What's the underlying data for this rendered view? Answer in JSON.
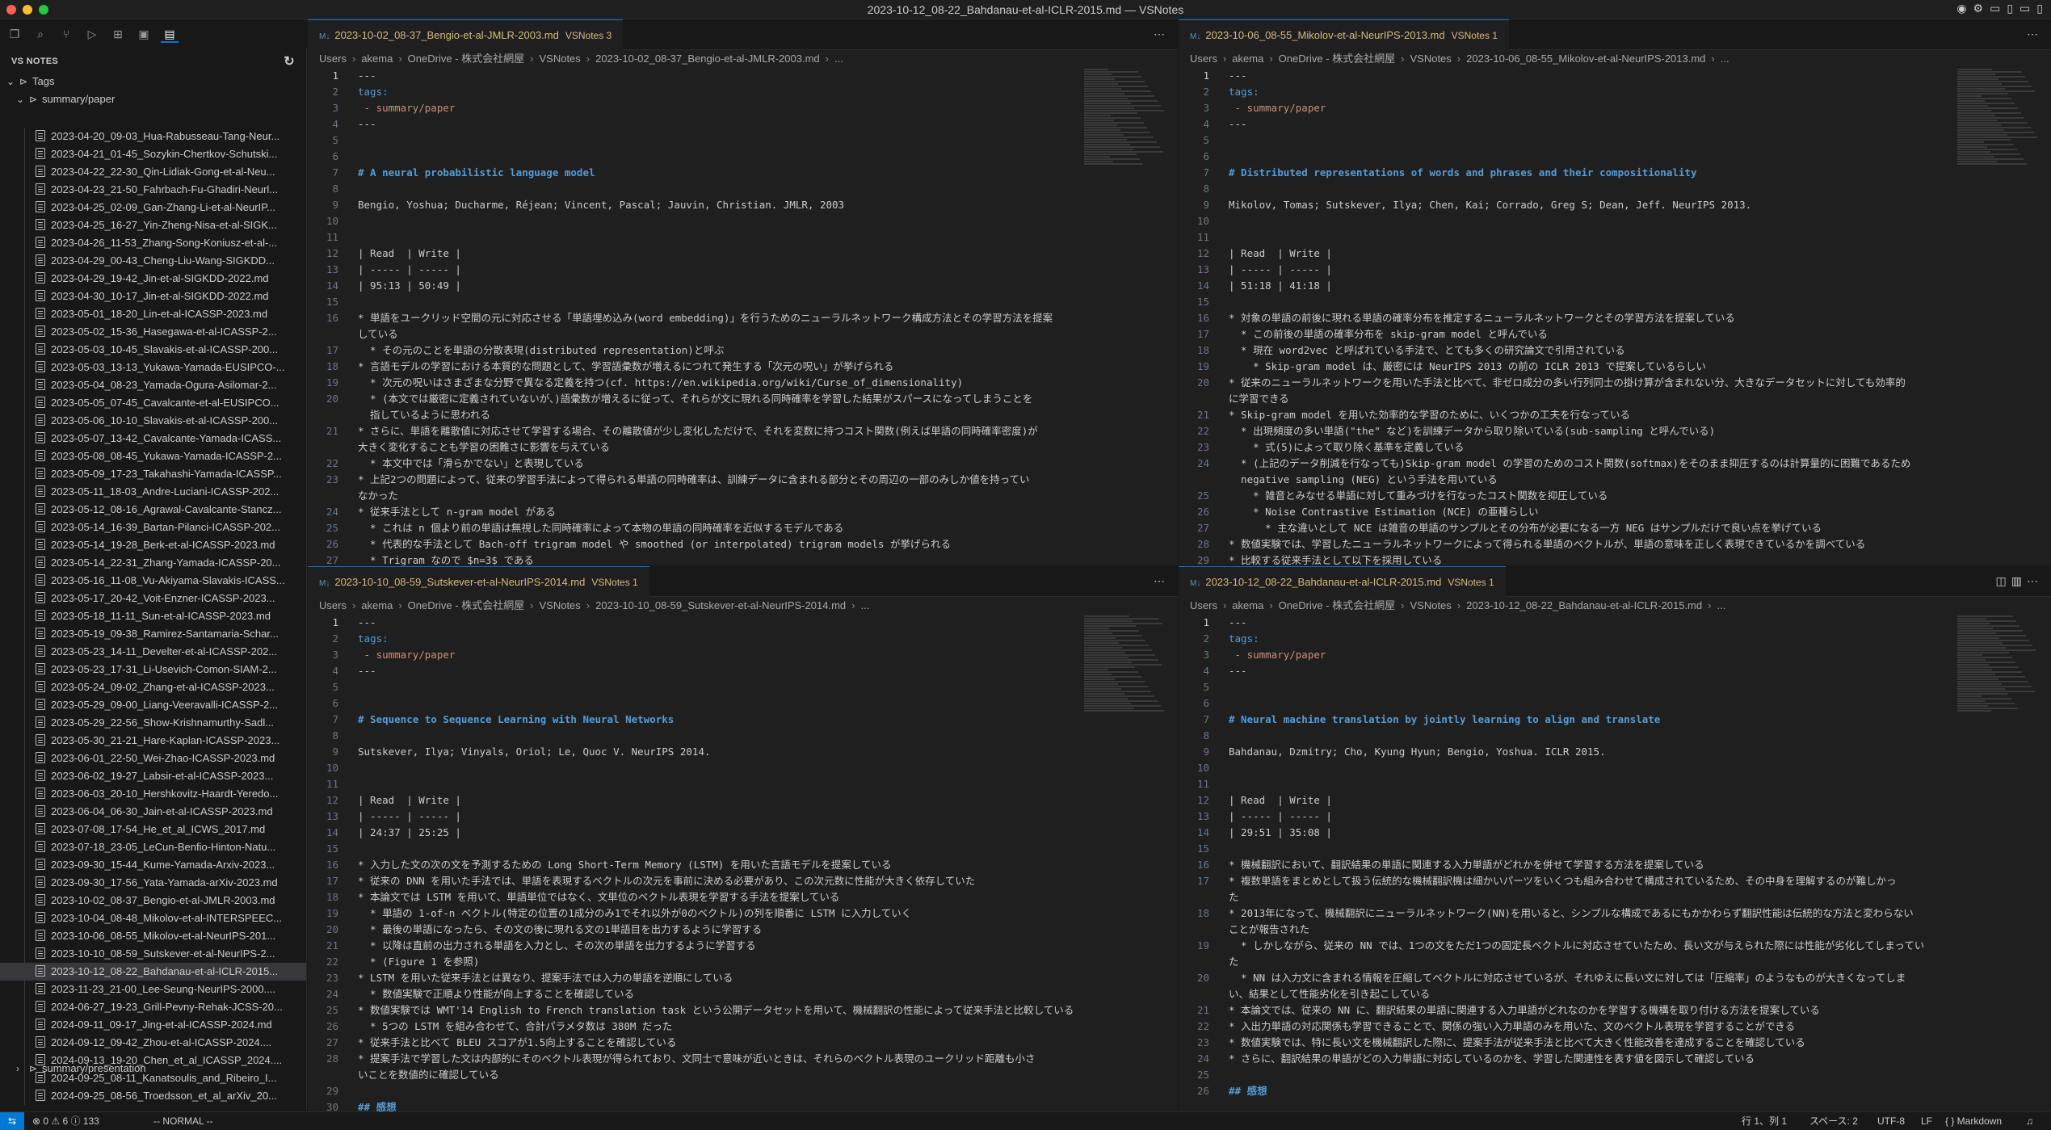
{
  "window": {
    "title": "2023-10-12_08-22_Bahdanau-et-al-ICLR-2015.md — VSNotes"
  },
  "sidebar": {
    "header": "VS NOTES",
    "tags_label": "Tags",
    "folder_label": "summary/paper",
    "files": [
      "2023-04-20_09-03_Hua-Rabusseau-Tang-Neur...",
      "2023-04-21_01-45_Sozykin-Chertkov-Schutski...",
      "2023-04-22_22-30_Qin-Lidiak-Gong-et-al-Neu...",
      "2023-04-23_21-50_Fahrbach-Fu-Ghadiri-Neurl...",
      "2023-04-25_02-09_Gan-Zhang-Li-et-al-NeurIP...",
      "2023-04-25_16-27_Yin-Zheng-Nisa-et-al-SIGK...",
      "2023-04-26_11-53_Zhang-Song-Koniusz-et-al-...",
      "2023-04-29_00-43_Cheng-Liu-Wang-SIGKDD...",
      "2023-04-29_19-42_Jin-et-al-SIGKDD-2022.md",
      "2023-04-30_10-17_Jin-et-al-SIGKDD-2022.md",
      "2023-05-01_18-20_Lin-et-al-ICASSP-2023.md",
      "2023-05-02_15-36_Hasegawa-et-al-ICASSP-2...",
      "2023-05-03_10-45_Slavakis-et-al-ICASSP-200...",
      "2023-05-03_13-13_Yukawa-Yamada-EUSIPCO-...",
      "2023-05-04_08-23_Yamada-Ogura-Asilomar-2...",
      "2023-05-05_07-45_Cavalcante-et-al-EUSIPCO...",
      "2023-05-06_10-10_Slavakis-et-al-ICASSP-200...",
      "2023-05-07_13-42_Cavalcante-Yamada-ICASS...",
      "2023-05-08_08-45_Yukawa-Yamada-ICASSP-2...",
      "2023-05-09_17-23_Takahashi-Yamada-ICASSP...",
      "2023-05-11_18-03_Andre-Luciani-ICASSP-202...",
      "2023-05-12_08-16_Agrawal-Cavalcante-Stancz...",
      "2023-05-14_16-39_Bartan-Pilanci-ICASSP-202...",
      "2023-05-14_19-28_Berk-et-al-ICASSP-2023.md",
      "2023-05-14_22-31_Zhang-Yamada-ICASSP-20...",
      "2023-05-16_11-08_Vu-Akiyama-Slavakis-ICASS...",
      "2023-05-17_20-42_Voit-Enzner-ICASSP-2023...",
      "2023-05-18_11-11_Sun-et-al-ICASSP-2023.md",
      "2023-05-19_09-38_Ramirez-Santamaria-Schar...",
      "2023-05-23_14-11_Develter-et-al-ICASSP-202...",
      "2023-05-23_17-31_Li-Usevich-Comon-SIAM-2...",
      "2023-05-24_09-02_Zhang-et-al-ICASSP-2023...",
      "2023-05-29_09-00_Liang-Veeravalli-ICASSP-2...",
      "2023-05-29_22-56_Show-Krishnamurthy-Sadl...",
      "2023-05-30_21-21_Hare-Kaplan-ICASSP-2023...",
      "2023-06-01_22-50_Wei-Zhao-ICASSP-2023.md",
      "2023-06-02_19-27_Labsir-et-al-ICASSP-2023...",
      "2023-06-03_20-10_Hershkovitz-Haardt-Yeredo...",
      "2023-06-04_06-30_Jain-et-al-ICASSP-2023.md",
      "2023-07-08_17-54_He_et_al_ICWS_2017.md",
      "2023-07-18_23-05_LeCun-Benfio-Hinton-Natu...",
      "2023-09-30_15-44_Kume-Yamada-Arxiv-2023...",
      "2023-09-30_17-56_Yata-Yamada-arXiv-2023.md",
      "2023-10-02_08-37_Bengio-et-al-JMLR-2003.md",
      "2023-10-04_08-48_Mikolov-et-al-INTERSPEEC...",
      "2023-10-06_08-55_Mikolov-et-al-NeurIPS-201...",
      "2023-10-10_08-59_Sutskever-et-al-NeurIPS-2...",
      "2023-10-12_08-22_Bahdanau-et-al-ICLR-2015...",
      "2023-11-23_21-00_Lee-Seung-NeurIPS-2000....",
      "2024-06-27_19-23_Grill-Pevny-Rehak-JCSS-20...",
      "2024-09-11_09-17_Jing-et-al-ICASSP-2024.md",
      "2024-09-12_09-42_Zhou-et-al-ICASSP-2024....",
      "2024-09-13_19-20_Chen_et_al_ICASSP_2024....",
      "2024-09-25_08-11_Kanatsoulis_and_Ribeiro_I...",
      "2024-09-25_08-56_Troedsson_et_al_arXiv_20..."
    ],
    "selected_index": 47,
    "bottom_label": "summary/presentation"
  },
  "statusbar": {
    "left": "⊗ 0 ⚠ 6 ⓘ 133",
    "mode": "-- NORMAL --",
    "position": "行 1、列 1",
    "spaces": "スペース: 2",
    "encoding": "UTF-8",
    "eol": "LF",
    "language": "{ } Markdown"
  },
  "panes": [
    {
      "tab": "2023-10-02_08-37_Bengio-et-al-JMLR-2003.md",
      "badge": "VSNotes 3",
      "crumbs": [
        "Users",
        "akema",
        "OneDrive - 株式会社網屋",
        "VSNotes",
        "2023-10-02_08-37_Bengio-et-al-JMLR-2003.md",
        "..."
      ],
      "lines": [
        {
          "n": "1",
          "t": "---"
        },
        {
          "n": "2",
          "t": "tags:",
          "c": "key"
        },
        {
          "n": "3",
          "t": " - summary/paper",
          "c": "tagv"
        },
        {
          "n": "4",
          "t": "---"
        },
        {
          "n": "5",
          "t": ""
        },
        {
          "n": "6",
          "t": ""
        },
        {
          "n": "7",
          "t": "# A neural probabilistic language model",
          "c": "h"
        },
        {
          "n": "8",
          "t": ""
        },
        {
          "n": "9",
          "t": "Bengio, Yoshua; Ducharme, Réjean; Vincent, Pascal; Jauvin, Christian. JMLR, 2003"
        },
        {
          "n": "10",
          "t": ""
        },
        {
          "n": "11",
          "t": ""
        },
        {
          "n": "12",
          "t": "| Read  | Write |"
        },
        {
          "n": "13",
          "t": "| ----- | ----- |"
        },
        {
          "n": "14",
          "t": "| 95:13 | 50:49 |"
        },
        {
          "n": "15",
          "t": ""
        },
        {
          "n": "16",
          "t": "* 単語をユークリッド空間の元に対応させる「単語埋め込み(word embedding)」を行うためのニューラルネットワーク構成方法とその学習方法を提案"
        },
        {
          "n": "",
          "t": "している"
        },
        {
          "n": "17",
          "t": "  * その元のことを単語の分散表現(distributed representation)と呼ぶ"
        },
        {
          "n": "18",
          "t": "* 言語モデルの学習における本質的な問題として、学習語彙数が増えるにつれて発生する「次元の呪い」が挙げられる"
        },
        {
          "n": "19",
          "t": "  * 次元の呪いはさまざまな分野で異なる定義を持つ(cf. https://en.wikipedia.org/wiki/Curse_of_dimensionality)"
        },
        {
          "n": "20",
          "t": "  * (本文では厳密に定義されていないが、)語彙数が増えるに従って、それらが文に現れる同時確率を学習した結果がスパースになってしまうことを"
        },
        {
          "n": "",
          "t": "  指しているように思われる"
        },
        {
          "n": "21",
          "t": "* さらに、単語を離散値に対応させて学習する場合、その離散値が少し変化しただけで、それを変数に持つコスト関数(例えば単語の同時確率密度)が"
        },
        {
          "n": "",
          "t": "大きく変化することも学習の困難さに影響を与えている"
        },
        {
          "n": "22",
          "t": "  * 本文中では「滑らかでない」と表現している"
        },
        {
          "n": "23",
          "t": "* 上記2つの問題によって、従来の学習手法によって得られる単語の同時確率は、訓練データに含まれる部分とその周辺の一部のみしか値を持ってい"
        },
        {
          "n": "",
          "t": "なかった"
        },
        {
          "n": "24",
          "t": "* 従来手法として n-gram model がある"
        },
        {
          "n": "25",
          "t": "  * これは n 個より前の単語は無視した同時確率によって本物の単語の同時確率を近似するモデルである"
        },
        {
          "n": "26",
          "t": "  * 代表的な手法として Bach-off trigram model や smoothed (or interpolated) trigram models が挙げられる"
        },
        {
          "n": "27",
          "t": "  * Trigram なので $n=3$ である"
        }
      ]
    },
    {
      "tab": "2023-10-06_08-55_Mikolov-et-al-NeurIPS-2013.md",
      "badge": "VSNotes 1",
      "crumbs": [
        "Users",
        "akema",
        "OneDrive - 株式会社網屋",
        "VSNotes",
        "2023-10-06_08-55_Mikolov-et-al-NeurIPS-2013.md",
        "..."
      ],
      "lines": [
        {
          "n": "1",
          "t": "---"
        },
        {
          "n": "2",
          "t": "tags:",
          "c": "key"
        },
        {
          "n": "3",
          "t": " - summary/paper",
          "c": "tagv"
        },
        {
          "n": "4",
          "t": "---"
        },
        {
          "n": "5",
          "t": ""
        },
        {
          "n": "6",
          "t": ""
        },
        {
          "n": "7",
          "t": "# Distributed representations of words and phrases and their compositionality",
          "c": "h"
        },
        {
          "n": "8",
          "t": ""
        },
        {
          "n": "9",
          "t": "Mikolov, Tomas; Sutskever, Ilya; Chen, Kai; Corrado, Greg S; Dean, Jeff. NeurIPS 2013."
        },
        {
          "n": "10",
          "t": ""
        },
        {
          "n": "11",
          "t": ""
        },
        {
          "n": "12",
          "t": "| Read  | Write |"
        },
        {
          "n": "13",
          "t": "| ----- | ----- |"
        },
        {
          "n": "14",
          "t": "| 51:18 | 41:18 |"
        },
        {
          "n": "15",
          "t": ""
        },
        {
          "n": "16",
          "t": "* 対象の単語の前後に現れる単語の確率分布を推定するニューラルネットワークとその学習方法を提案している"
        },
        {
          "n": "17",
          "t": "  * この前後の単語の確率分布を skip-gram model と呼んでいる"
        },
        {
          "n": "18",
          "t": "  * 現在 word2vec と呼ばれている手法で、とても多くの研究論文で引用されている"
        },
        {
          "n": "19",
          "t": "    * Skip-gram model は、厳密には NeurIPS 2013 の前の ICLR 2013 で提案しているらしい"
        },
        {
          "n": "20",
          "t": "* 従来のニューラルネットワークを用いた手法と比べて、非ゼロ成分の多い行列同士の掛け算が含まれない分、大きなデータセットに対しても効率的"
        },
        {
          "n": "",
          "t": "に学習できる"
        },
        {
          "n": "21",
          "t": "* Skip-gram model を用いた効率的な学習のために、いくつかの工夫を行なっている"
        },
        {
          "n": "22",
          "t": "  * 出現頻度の多い単語(\"the\" など)を訓練データから取り除いている(sub-sampling と呼んでいる)"
        },
        {
          "n": "23",
          "t": "    * 式(5)によって取り除く基準を定義している"
        },
        {
          "n": "24",
          "t": "  * (上記のデータ削減を行なっても)Skip-gram model の学習のためのコスト関数(softmax)をそのまま抑圧するのは計算量的に困難であるため"
        },
        {
          "n": "",
          "t": "  negative sampling (NEG) という手法を用いている"
        },
        {
          "n": "25",
          "t": "    * 雑音とみなせる単語に対して重みづけを行なったコスト関数を抑圧している"
        },
        {
          "n": "26",
          "t": "    * Noise Contrastive Estimation (NCE) の亜種らしい"
        },
        {
          "n": "27",
          "t": "      * 主な違いとして NCE は雑音の単語のサンプルとその分布が必要になる一方 NEG はサンプルだけで良い点を挙げている"
        },
        {
          "n": "28",
          "t": "* 数値実験では、学習したニューラルネットワークによって得られる単語のベクトルが、単語の意味を正しく表現できているかを調べている"
        },
        {
          "n": "29",
          "t": "* 比較する従来手法として以下を採用している"
        }
      ]
    },
    {
      "tab": "2023-10-10_08-59_Sutskever-et-al-NeurIPS-2014.md",
      "badge": "VSNotes 1",
      "crumbs": [
        "Users",
        "akema",
        "OneDrive - 株式会社網屋",
        "VSNotes",
        "2023-10-10_08-59_Sutskever-et-al-NeurIPS-2014.md",
        "..."
      ],
      "lines": [
        {
          "n": "1",
          "t": "---"
        },
        {
          "n": "2",
          "t": "tags:",
          "c": "key"
        },
        {
          "n": "3",
          "t": " - summary/paper",
          "c": "tagv"
        },
        {
          "n": "4",
          "t": "---"
        },
        {
          "n": "5",
          "t": ""
        },
        {
          "n": "6",
          "t": ""
        },
        {
          "n": "7",
          "t": "# Sequence to Sequence Learning with Neural Networks",
          "c": "h"
        },
        {
          "n": "8",
          "t": ""
        },
        {
          "n": "9",
          "t": "Sutskever, Ilya; Vinyals, Oriol; Le, Quoc V. NeurIPS 2014."
        },
        {
          "n": "10",
          "t": ""
        },
        {
          "n": "11",
          "t": ""
        },
        {
          "n": "12",
          "t": "| Read  | Write |"
        },
        {
          "n": "13",
          "t": "| ----- | ----- |"
        },
        {
          "n": "14",
          "t": "| 24:37 | 25:25 |"
        },
        {
          "n": "15",
          "t": ""
        },
        {
          "n": "16",
          "t": "* 入力した文の次の文を予測するための Long Short-Term Memory (LSTM) を用いた言語モデルを提案している"
        },
        {
          "n": "17",
          "t": "* 従来の DNN を用いた手法では、単語を表現するベクトルの次元を事前に決める必要があり、この次元数に性能が大きく依存していた"
        },
        {
          "n": "18",
          "t": "* 本論文では LSTM を用いて、単語単位ではなく、文単位のベクトル表現を学習する手法を提案している"
        },
        {
          "n": "19",
          "t": "  * 単語の 1-of-n ベクトル(特定の位置の1成分のみ1でそれ以外が0のベクトル)の列を順番に LSTM に入力していく"
        },
        {
          "n": "20",
          "t": "  * 最後の単語になったら、その文の後に現れる文の1単語目を出力するように学習する"
        },
        {
          "n": "21",
          "t": "  * 以降は直前の出力される単語を入力とし、その次の単語を出力するように学習する"
        },
        {
          "n": "22",
          "t": "  * (Figure 1 を参照)"
        },
        {
          "n": "23",
          "t": "* LSTM を用いた従来手法とは異なり、提案手法では入力の単語を逆順にしている"
        },
        {
          "n": "24",
          "t": "  * 数値実験で正順より性能が向上することを確認している"
        },
        {
          "n": "25",
          "t": "* 数値実験では WMT'14 English to French translation task という公開データセットを用いて、機械翻訳の性能によって従来手法と比較している"
        },
        {
          "n": "26",
          "t": "  * 5つの LSTM を組み合わせて、合計パラメタ数は 380M だった"
        },
        {
          "n": "27",
          "t": "* 従来手法と比べて BLEU スコアが1.5向上することを確認している"
        },
        {
          "n": "28",
          "t": "* 提案手法で学習した文は内部的にそのベクトル表現が得られており、文同士で意味が近いときは、それらのベクトル表現のユークリッド距離も小さ"
        },
        {
          "n": "",
          "t": "いことを数値的に確認している"
        },
        {
          "n": "29",
          "t": ""
        },
        {
          "n": "30",
          "t": "## 感想",
          "c": "h"
        }
      ]
    },
    {
      "tab": "2023-10-12_08-22_Bahdanau-et-al-ICLR-2015.md",
      "badge": "VSNotes 1",
      "crumbs": [
        "Users",
        "akema",
        "OneDrive - 株式会社網屋",
        "VSNotes",
        "2023-10-12_08-22_Bahdanau-et-al-ICLR-2015.md",
        "..."
      ],
      "lines": [
        {
          "n": "1",
          "t": "---"
        },
        {
          "n": "2",
          "t": "tags:",
          "c": "key"
        },
        {
          "n": "3",
          "t": " - summary/paper",
          "c": "tagv"
        },
        {
          "n": "4",
          "t": "---"
        },
        {
          "n": "5",
          "t": ""
        },
        {
          "n": "6",
          "t": ""
        },
        {
          "n": "7",
          "t": "# Neural machine translation by jointly learning to align and translate",
          "c": "h"
        },
        {
          "n": "8",
          "t": ""
        },
        {
          "n": "9",
          "t": "Bahdanau, Dzmitry; Cho, Kyung Hyun; Bengio, Yoshua. ICLR 2015."
        },
        {
          "n": "10",
          "t": ""
        },
        {
          "n": "11",
          "t": ""
        },
        {
          "n": "12",
          "t": "| Read  | Write |"
        },
        {
          "n": "13",
          "t": "| ----- | ----- |"
        },
        {
          "n": "14",
          "t": "| 29:51 | 35:08 |"
        },
        {
          "n": "15",
          "t": ""
        },
        {
          "n": "16",
          "t": "* 機械翻訳において、翻訳結果の単語に関連する入力単語がどれかを併せて学習する方法を提案している"
        },
        {
          "n": "17",
          "t": "* 複数単語をまとめとして扱う伝統的な機械翻訳機は細かいパーツをいくつも組み合わせて構成されているため、その中身を理解するのが難しかっ"
        },
        {
          "n": "",
          "t": "た"
        },
        {
          "n": "18",
          "t": "* 2013年になって、機械翻訳にニューラルネットワーク(NN)を用いると、シンプルな構成であるにもかかわらず翻訳性能は伝統的な方法と変わらない"
        },
        {
          "n": "",
          "t": "ことが報告された"
        },
        {
          "n": "19",
          "t": "  * しかしながら、従来の NN では、1つの文をただ1つの固定長ベクトルに対応させていたため、長い文が与えられた際には性能が劣化してしまってい"
        },
        {
          "n": "",
          "t": "た"
        },
        {
          "n": "20",
          "t": "  * NN は入力文に含まれる情報を圧縮してベクトルに対応させているが、それゆえに長い文に対しては「圧縮率」のようなものが大きくなってしま"
        },
        {
          "n": "",
          "t": "い、結果として性能劣化を引き起こしている"
        },
        {
          "n": "21",
          "t": "* 本論文では、従来の NN に、翻訳結果の単語に関連する入力単語がどれなのかを学習する機構を取り付ける方法を提案している"
        },
        {
          "n": "22",
          "t": "* 入出力単語の対応関係も学習できることで、関係の強い入力単語のみを用いた、文のベクトル表現を学習することができる"
        },
        {
          "n": "23",
          "t": "* 数値実験では、特に長い文を機械翻訳した際に、提案手法が従来手法と比べて大きく性能改善を達成することを確認している"
        },
        {
          "n": "24",
          "t": "* さらに、翻訳結果の単語がどの入力単語に対応しているのかを、学習した関連性を表す値を図示して確認している"
        },
        {
          "n": "25",
          "t": ""
        },
        {
          "n": "26",
          "t": "## 感想",
          "c": "h"
        }
      ]
    }
  ]
}
